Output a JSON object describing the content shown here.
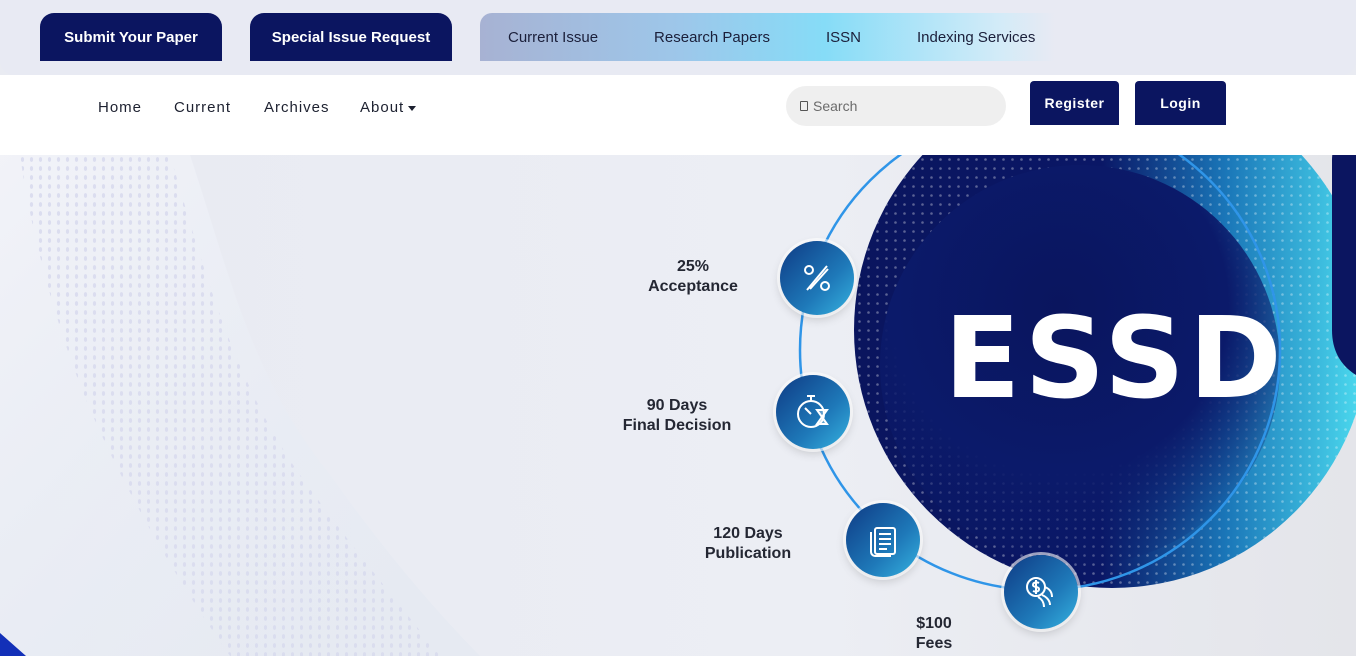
{
  "topbar": {
    "submit_label": "Submit Your Paper",
    "special_label": "Special Issue Request",
    "links": [
      "Current Issue",
      "Research Papers",
      "ISSN",
      "Indexing Services"
    ]
  },
  "nav": {
    "items": [
      "Home",
      "Current",
      "Archives",
      "About"
    ],
    "search_placeholder": "Search",
    "register_label": "Register",
    "login_label": "Login"
  },
  "hero": {
    "brand": "ESSD",
    "stats": [
      {
        "line1": "25%",
        "line2": "Acceptance",
        "icon": "percent-icon"
      },
      {
        "line1": "90 Days",
        "line2": "Final Decision",
        "icon": "stopwatch-hourglass-icon"
      },
      {
        "line1": "120 Days",
        "line2": "Publication",
        "icon": "document-icon"
      },
      {
        "line1": "$100",
        "line2": "Fees",
        "icon": "coins-icon"
      }
    ]
  },
  "colors": {
    "navy": "#0b1560",
    "cyan": "#4ad8ef",
    "ring": "#2f95e8"
  }
}
